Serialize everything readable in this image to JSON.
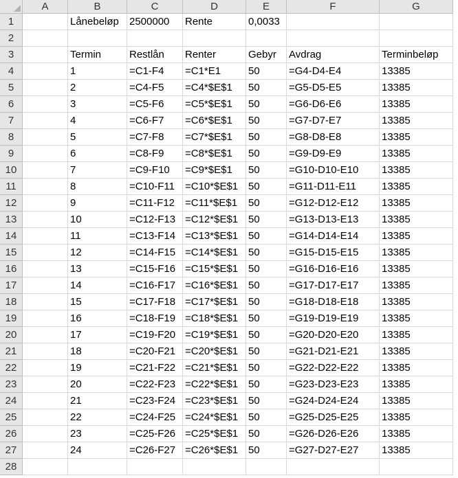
{
  "columns": [
    "A",
    "B",
    "C",
    "D",
    "E",
    "F",
    "G"
  ],
  "rows": [
    {
      "num": "1",
      "cells": [
        "",
        "Lånebeløp",
        "2500000",
        "Rente",
        "0,0033",
        "",
        ""
      ]
    },
    {
      "num": "2",
      "cells": [
        "",
        "",
        "",
        "",
        "",
        "",
        ""
      ]
    },
    {
      "num": "3",
      "cells": [
        "",
        "Termin",
        "Restlån",
        "Renter",
        "Gebyr",
        "Avdrag",
        "Terminbeløp"
      ]
    },
    {
      "num": "4",
      "cells": [
        "",
        "1",
        "=C1-F4",
        "=C1*E1",
        "50",
        "=G4-D4-E4",
        "13385"
      ]
    },
    {
      "num": "5",
      "cells": [
        "",
        "2",
        "=C4-F5",
        "=C4*$E$1",
        "50",
        "=G5-D5-E5",
        "13385"
      ]
    },
    {
      "num": "6",
      "cells": [
        "",
        "3",
        "=C5-F6",
        "=C5*$E$1",
        "50",
        "=G6-D6-E6",
        "13385"
      ]
    },
    {
      "num": "7",
      "cells": [
        "",
        "4",
        "=C6-F7",
        "=C6*$E$1",
        "50",
        "=G7-D7-E7",
        "13385"
      ]
    },
    {
      "num": "8",
      "cells": [
        "",
        "5",
        "=C7-F8",
        "=C7*$E$1",
        "50",
        "=G8-D8-E8",
        "13385"
      ]
    },
    {
      "num": "9",
      "cells": [
        "",
        "6",
        "=C8-F9",
        "=C8*$E$1",
        "50",
        "=G9-D9-E9",
        "13385"
      ]
    },
    {
      "num": "10",
      "cells": [
        "",
        "7",
        "=C9-F10",
        "=C9*$E$1",
        "50",
        "=G10-D10-E10",
        "13385"
      ]
    },
    {
      "num": "11",
      "cells": [
        "",
        "8",
        "=C10-F11",
        "=C10*$E$1",
        "50",
        "=G11-D11-E11",
        "13385"
      ]
    },
    {
      "num": "12",
      "cells": [
        "",
        "9",
        "=C11-F12",
        "=C11*$E$1",
        "50",
        "=G12-D12-E12",
        "13385"
      ]
    },
    {
      "num": "13",
      "cells": [
        "",
        "10",
        "=C12-F13",
        "=C12*$E$1",
        "50",
        "=G13-D13-E13",
        "13385"
      ]
    },
    {
      "num": "14",
      "cells": [
        "",
        "11",
        "=C13-F14",
        "=C13*$E$1",
        "50",
        "=G14-D14-E14",
        "13385"
      ]
    },
    {
      "num": "15",
      "cells": [
        "",
        "12",
        "=C14-F15",
        "=C14*$E$1",
        "50",
        "=G15-D15-E15",
        "13385"
      ]
    },
    {
      "num": "16",
      "cells": [
        "",
        "13",
        "=C15-F16",
        "=C15*$E$1",
        "50",
        "=G16-D16-E16",
        "13385"
      ]
    },
    {
      "num": "17",
      "cells": [
        "",
        "14",
        "=C16-F17",
        "=C16*$E$1",
        "50",
        "=G17-D17-E17",
        "13385"
      ]
    },
    {
      "num": "18",
      "cells": [
        "",
        "15",
        "=C17-F18",
        "=C17*$E$1",
        "50",
        "=G18-D18-E18",
        "13385"
      ]
    },
    {
      "num": "19",
      "cells": [
        "",
        "16",
        "=C18-F19",
        "=C18*$E$1",
        "50",
        "=G19-D19-E19",
        "13385"
      ]
    },
    {
      "num": "20",
      "cells": [
        "",
        "17",
        "=C19-F20",
        "=C19*$E$1",
        "50",
        "=G20-D20-E20",
        "13385"
      ]
    },
    {
      "num": "21",
      "cells": [
        "",
        "18",
        "=C20-F21",
        "=C20*$E$1",
        "50",
        "=G21-D21-E21",
        "13385"
      ]
    },
    {
      "num": "22",
      "cells": [
        "",
        "19",
        "=C21-F22",
        "=C21*$E$1",
        "50",
        "=G22-D22-E22",
        "13385"
      ]
    },
    {
      "num": "23",
      "cells": [
        "",
        "20",
        "=C22-F23",
        "=C22*$E$1",
        "50",
        "=G23-D23-E23",
        "13385"
      ]
    },
    {
      "num": "24",
      "cells": [
        "",
        "21",
        "=C23-F24",
        "=C23*$E$1",
        "50",
        "=G24-D24-E24",
        "13385"
      ]
    },
    {
      "num": "25",
      "cells": [
        "",
        "22",
        "=C24-F25",
        "=C24*$E$1",
        "50",
        "=G25-D25-E25",
        "13385"
      ]
    },
    {
      "num": "26",
      "cells": [
        "",
        "23",
        "=C25-F26",
        "=C25*$E$1",
        "50",
        "=G26-D26-E26",
        "13385"
      ]
    },
    {
      "num": "27",
      "cells": [
        "",
        "24",
        "=C26-F27",
        "=C26*$E$1",
        "50",
        "=G27-D27-E27",
        "13385"
      ]
    },
    {
      "num": "28",
      "cells": [
        "",
        "",
        "",
        "",
        "",
        "",
        ""
      ]
    }
  ]
}
